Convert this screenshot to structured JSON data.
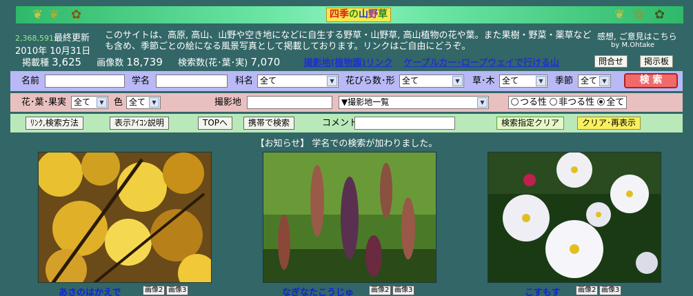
{
  "header": {
    "title_parts": [
      "四季",
      "の",
      "山",
      "野",
      "草"
    ],
    "left_icons": [
      "leaf-icon",
      "leaf-icon",
      "maple-leaf-icon"
    ],
    "right_icons": [
      "leaf-icon",
      "maple-leaf-icon",
      "maple-leaf-icon"
    ]
  },
  "stats": {
    "counter": "2,368,591",
    "last_update_label": "最終更新",
    "date": "2010年 10月31日",
    "species_label": "掲載種",
    "species_count": "3,625",
    "images_label": "画像数",
    "images_count": "18,739",
    "search_label": "検索数(花･葉･実)",
    "search_count": "7,070"
  },
  "description": "このサイトは、高原, 高山、山野や空き地になどに自生する野草・山野草, 高山植物の花や葉。また果樹・野菜・薬草なども含め、季節ごとの絵になる風景写真として掲載しております。リンクはご自由にどうぞ。",
  "feedback": {
    "text": "感想, ご意見はこちら",
    "author": "by M.Ohtake",
    "contact_button": "問合せ",
    "board_button": "掲示板"
  },
  "links": {
    "location_link": "撮影地(植物園)リンク",
    "cable_link": "ケーブルカー･ロープウェイで行ける山"
  },
  "search_form": {
    "name_label": "名前",
    "scientific_label": "学名",
    "family_label": "科名",
    "family_value": "全て",
    "petal_label": "花びら数･形",
    "petal_value": "全て",
    "plant_type_label": "草･木",
    "plant_type_value": "全て",
    "season_label": "季節",
    "season_value": "全て",
    "search_button": "検 索",
    "part_label": "花･葉･果実",
    "part_value": "全て",
    "color_label": "色",
    "color_value": "全て",
    "location_label": "撮影地",
    "location_list_value": "▼撮影地一覧",
    "vine_option": "つる性",
    "nonvine_option": "非つる性",
    "all_option": "全て"
  },
  "toolbar": {
    "link_search_button": "ﾘﾝｸ,検索方法",
    "icon_help_button": "表示ｱｲｺﾝ説明",
    "top_button": "TOPへ",
    "mobile_button": "携帯で検索",
    "comment_label": "コメント",
    "clear_button": "検索指定クリア",
    "reset_button": "クリア･再表示"
  },
  "notice": "【お知らせ】 学名での検索が加わりました。",
  "photos": [
    {
      "caption": "あさのはかえで",
      "btn2": "画像2",
      "btn3": "画像3"
    },
    {
      "caption": "なぎなたこうじゅ",
      "btn2": "画像2",
      "btn3": "画像3"
    },
    {
      "caption": "こすもす",
      "btn2": "画像2",
      "btn3": "画像3"
    }
  ]
}
